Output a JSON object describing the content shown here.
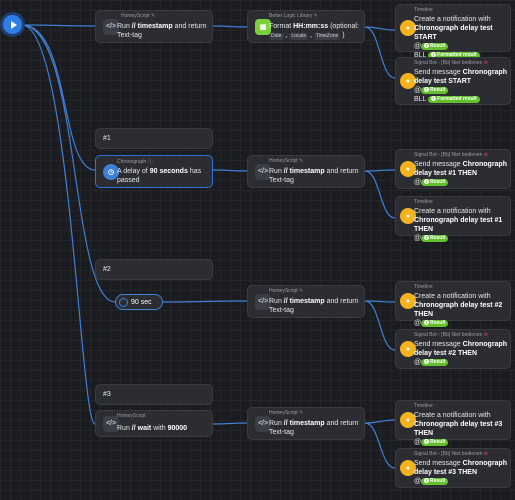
{
  "start": {
    "name": "play-icon"
  },
  "row1": {
    "script": {
      "header": "HomeyScript",
      "pre": "Run",
      "token": "// timestamp",
      "post": "and return Text-tag"
    },
    "blib": {
      "header": "Better Logic Library",
      "pre": "Format",
      "value": "HH:mm:ss",
      "post": "(optional:",
      "args": [
        "Date",
        "Locale",
        "TimeZone"
      ],
      "close": ")"
    },
    "timeline": {
      "header": "Timeline",
      "l1": "Create a notification with",
      "l2": "Chronograph delay test START",
      "at": "@",
      "result": "Result",
      "bll": "BLL",
      "formatted": "Formatted result"
    },
    "signal": {
      "header": "Signal Bot - [Bb] Niet bedienen",
      "pre": "Send message",
      "bold1": "Chronograph",
      "bold2": "delay test START",
      "at": "@",
      "result": "Result",
      "bll": "BLL",
      "formatted": "Formatted result"
    }
  },
  "labels": {
    "l1": "#1",
    "l2": "#2",
    "l3": "#3"
  },
  "row2": {
    "chrono": {
      "header": "Chronograph",
      "pre": "A delay of",
      "num": "90",
      "unit": "seconds",
      "post": "has passed"
    },
    "script": {
      "header": "HomeyScript",
      "pre": "Run",
      "token": "// timestamp",
      "post": "and return Text-tag"
    },
    "signal": {
      "header": "Signal Bot - [Bb] Niet bedienen",
      "pre": "Send message",
      "bold1": "Chronograph",
      "bold2": "delay test #1 THEN",
      "at": "@",
      "result": "Result"
    },
    "timeline": {
      "header": "Timeline",
      "l1": "Create a notification with",
      "l2": "Chronograph delay test #1 THEN",
      "at": "@",
      "result": "Result"
    }
  },
  "row3": {
    "delay": "90 sec",
    "script": {
      "header": "HomeyScript",
      "pre": "Run",
      "token": "// timestamp",
      "post": "and return Text-tag"
    },
    "timeline": {
      "header": "Timeline",
      "l1": "Create a notification with",
      "l2": "Chronograph delay test #2 THEN",
      "at": "@",
      "result": "Result"
    },
    "signal": {
      "header": "Signal Bot - [Bb] Niet bedienen",
      "pre": "Send message",
      "bold1": "Chronograph",
      "bold2": "delay test #2 THEN",
      "at": "@",
      "result": "Result"
    }
  },
  "row4": {
    "wait": {
      "header": "HomeyScript",
      "pre": "Run",
      "token": "// wait",
      "mid": "with",
      "num": "90000"
    },
    "script": {
      "header": "HomeyScript",
      "pre": "Run",
      "token": "// timestamp",
      "post": "and return Text-tag"
    },
    "timeline": {
      "header": "Timeline",
      "l1": "Create a notification with",
      "l2": "Chronograph delay test #3 THEN",
      "at": "@",
      "result": "Result"
    },
    "signal": {
      "header": "Signal Bot - [Bb] Niet bedienen",
      "pre": "Send message",
      "bold1": "Chronograph",
      "bold2": "delay test #3 THEN",
      "at": "@",
      "result": "Result"
    }
  },
  "colors": {
    "wire": "#3f7fd6",
    "result": "#62c12a",
    "bell": "#f3b21e",
    "blib": "#7bd13a"
  }
}
